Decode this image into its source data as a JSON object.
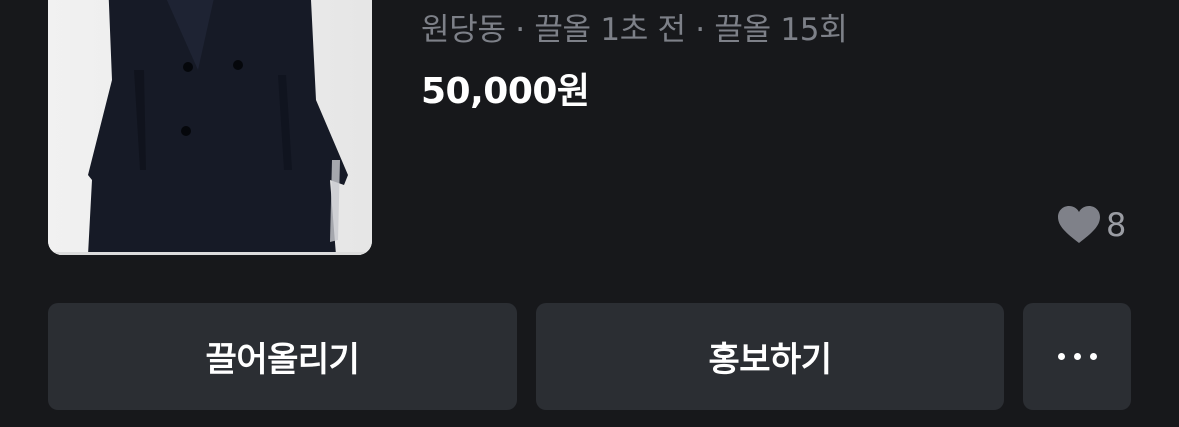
{
  "listing": {
    "meta": "원당동 · 끌올 1초 전 · 끌올 15회",
    "price": "50,000원",
    "like_count": "8",
    "image_icon": "coat-photo"
  },
  "actions": {
    "bump_label": "끌어올리기",
    "promote_label": "홍보하기",
    "more_icon": "more-dots-icon"
  },
  "colors": {
    "background": "#17181b",
    "button_bg": "#2b2e33",
    "meta_text": "#7d8088",
    "heart": "#7f8189"
  }
}
